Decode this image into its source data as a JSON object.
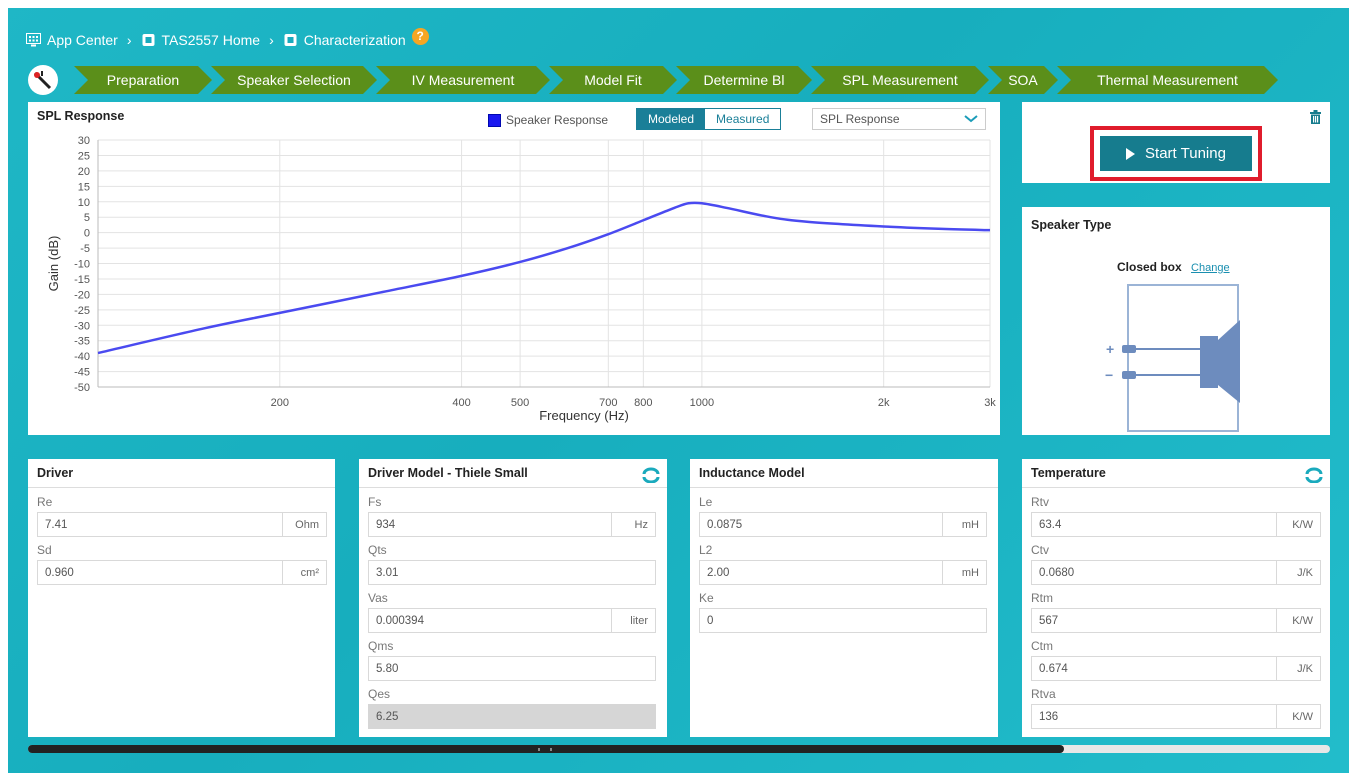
{
  "breadcrumb": [
    {
      "label": "App Center",
      "icon": "app-grid-icon"
    },
    {
      "label": "TAS2557 Home",
      "icon": "chip-icon"
    },
    {
      "label": "Characterization",
      "icon": "chip-icon"
    }
  ],
  "breadcrumb_separator": "›",
  "help_badge": "?",
  "wizard_steps": [
    "Preparation",
    "Speaker Selection",
    "IV Measurement",
    "Model Fit",
    "Determine Bl",
    "SPL Measurement",
    "SOA",
    "Thermal Measurement"
  ],
  "spl_panel": {
    "title": "SPL Response",
    "legend_label": "Speaker Response",
    "toggle_modeled": "Modeled",
    "toggle_measured": "Measured",
    "select_value": "SPL Response"
  },
  "chart_data": {
    "type": "line",
    "xlabel": "Frequency (Hz)",
    "ylabel": "Gain (dB)",
    "x_scale": "log",
    "xlim": [
      100,
      3000
    ],
    "ylim": [
      -50,
      30
    ],
    "grid": true,
    "y_ticks": [
      30,
      25,
      20,
      15,
      10,
      5,
      0,
      -5,
      -10,
      -15,
      -20,
      -25,
      -30,
      -35,
      -40,
      -45,
      -50
    ],
    "x_ticks": [
      {
        "v": 200,
        "label": "200"
      },
      {
        "v": 400,
        "label": "400"
      },
      {
        "v": 500,
        "label": "500"
      },
      {
        "v": 700,
        "label": "700"
      },
      {
        "v": 800,
        "label": "800"
      },
      {
        "v": 1000,
        "label": "1000"
      },
      {
        "v": 2000,
        "label": "2k"
      },
      {
        "v": 3000,
        "label": "3k"
      }
    ],
    "series": [
      {
        "name": "Speaker Response",
        "color": "#4a4af0",
        "x": [
          100,
          150,
          200,
          300,
          400,
          500,
          600,
          700,
          800,
          900,
          950,
          1000,
          1100,
          1300,
          1500,
          2000,
          2500,
          3000
        ],
        "y": [
          -39,
          -31,
          -26,
          -19,
          -14,
          -9.5,
          -5,
          -0.5,
          4,
          8,
          9.5,
          9.5,
          8,
          5,
          3.5,
          2,
          1.2,
          0.8
        ]
      }
    ]
  },
  "tuning_panel": {
    "start_label": "Start Tuning"
  },
  "speaker_type": {
    "title": "Speaker Type",
    "mode": "Closed box",
    "change_label": "Change",
    "plus": "+",
    "minus": "−"
  },
  "driver": {
    "title": "Driver",
    "fields": [
      {
        "label": "Re",
        "value": "7.41",
        "unit": "Ohm"
      },
      {
        "label": "Sd",
        "value": "0.960",
        "unit": "cm²"
      }
    ]
  },
  "thiele": {
    "title": "Driver Model - Thiele Small",
    "fields": [
      {
        "label": "Fs",
        "value": "934",
        "unit": "Hz"
      },
      {
        "label": "Qts",
        "value": "3.01",
        "unit": ""
      },
      {
        "label": "Vas",
        "value": "0.000394",
        "unit": "liter"
      },
      {
        "label": "Qms",
        "value": "5.80",
        "unit": ""
      },
      {
        "label": "Qes",
        "value": "6.25",
        "unit": ""
      }
    ]
  },
  "inductance": {
    "title": "Inductance Model",
    "fields": [
      {
        "label": "Le",
        "value": "0.0875",
        "unit": "mH"
      },
      {
        "label": "L2",
        "value": "2.00",
        "unit": "mH"
      },
      {
        "label": "Ke",
        "value": "0",
        "unit": ""
      }
    ]
  },
  "temperature": {
    "title": "Temperature",
    "fields": [
      {
        "label": "Rtv",
        "value": "63.4",
        "unit": "K/W"
      },
      {
        "label": "Ctv",
        "value": "0.0680",
        "unit": "J/K"
      },
      {
        "label": "Rtm",
        "value": "567",
        "unit": "K/W"
      },
      {
        "label": "Ctm",
        "value": "0.674",
        "unit": "J/K"
      },
      {
        "label": "Rtva",
        "value": "136",
        "unit": "K/W"
      }
    ]
  },
  "colors": {
    "accent": "#167c8e",
    "wizard": "#5b8f1a",
    "highlight": "#e01c2c",
    "background": "#1fb7c6"
  }
}
